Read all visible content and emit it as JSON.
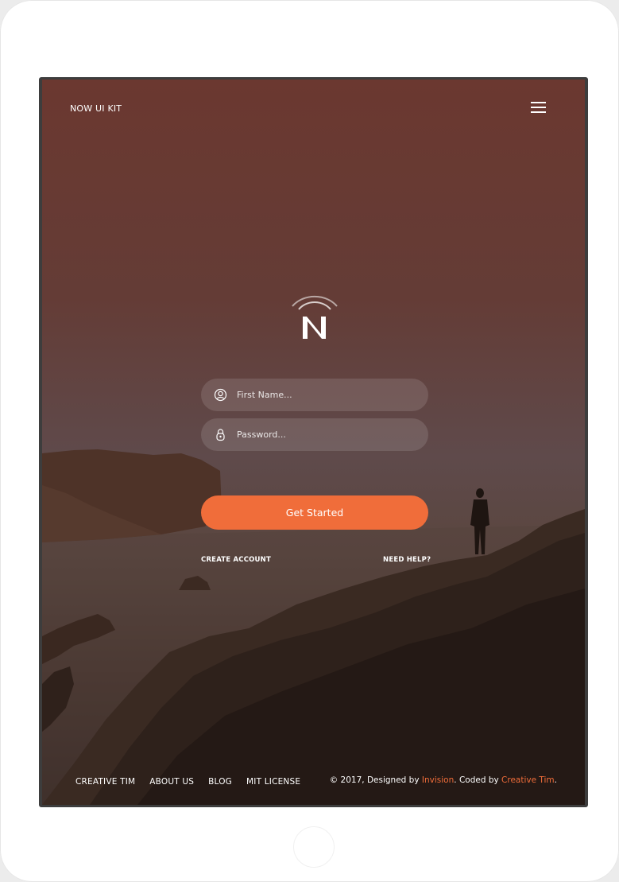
{
  "colors": {
    "accent": "#f06d3a",
    "overlay_top": "#6b3830",
    "overlay_bottom": "#251a16",
    "text": "#ffffff"
  },
  "navbar": {
    "brand": "NOW UI KIT",
    "menu_icon": "hamburger-menu-icon"
  },
  "logo": {
    "letter": "N",
    "icon": "signal-arcs-icon"
  },
  "form": {
    "first_name": {
      "placeholder": "First Name...",
      "value": "",
      "icon": "user-circle-icon"
    },
    "password": {
      "placeholder": "Password...",
      "value": "",
      "icon": "lock-icon"
    },
    "submit_label": "Get Started",
    "create_account": "CREATE ACCOUNT",
    "need_help": "NEED HELP?"
  },
  "footer": {
    "links": [
      "CREATIVE TIM",
      "ABOUT US",
      "BLOG",
      "MIT LICENSE"
    ],
    "copyright_prefix": "© 2017, Designed by",
    "designer": "Invision",
    "coded_by": ". Coded by",
    "coder": "Creative Tim",
    "end": "."
  }
}
